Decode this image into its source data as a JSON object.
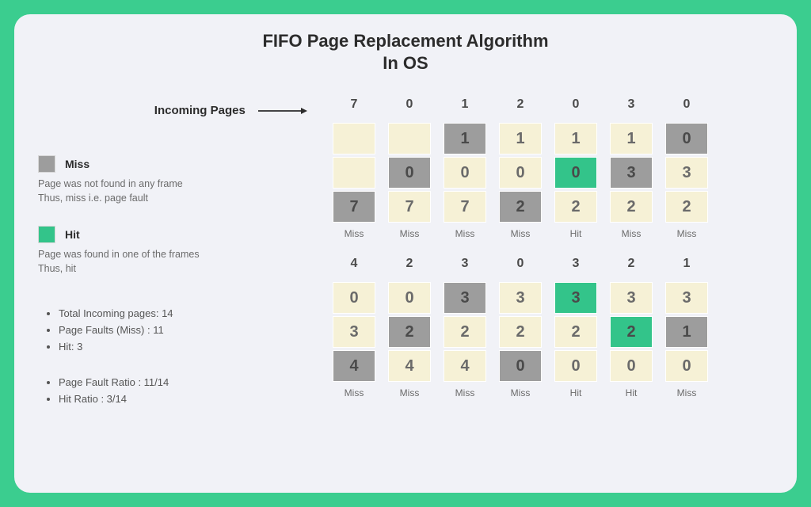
{
  "title_line1": "FIFO Page Replacement Algorithm",
  "title_line2": "In OS",
  "incoming_label": "Incoming Pages",
  "legend": {
    "miss": {
      "name": "Miss",
      "desc": "Page was not found in any frame\nThus, miss i.e. page fault"
    },
    "hit": {
      "name": "Hit",
      "desc": "Page was found in one of the frames\nThus, hit"
    }
  },
  "stats1": [
    "Total Incoming pages:  14",
    "Page Faults (Miss) : 11",
    "Hit: 3"
  ],
  "stats2": [
    "Page Fault Ratio : 11/14",
    "Hit Ratio : 3/14"
  ],
  "row1": [
    {
      "page": "7",
      "cells": [
        {
          "v": "",
          "c": "cream",
          "empty": true
        },
        {
          "v": "",
          "c": "cream",
          "empty": true
        },
        {
          "v": "7",
          "c": "gray"
        }
      ],
      "status": "Miss"
    },
    {
      "page": "0",
      "cells": [
        {
          "v": "",
          "c": "cream",
          "empty": true
        },
        {
          "v": "0",
          "c": "gray"
        },
        {
          "v": "7",
          "c": "cream"
        }
      ],
      "status": "Miss"
    },
    {
      "page": "1",
      "cells": [
        {
          "v": "1",
          "c": "gray"
        },
        {
          "v": "0",
          "c": "cream"
        },
        {
          "v": "7",
          "c": "cream"
        }
      ],
      "status": "Miss"
    },
    {
      "page": "2",
      "cells": [
        {
          "v": "1",
          "c": "cream"
        },
        {
          "v": "0",
          "c": "cream"
        },
        {
          "v": "2",
          "c": "gray"
        }
      ],
      "status": "Miss"
    },
    {
      "page": "0",
      "cells": [
        {
          "v": "1",
          "c": "cream"
        },
        {
          "v": "0",
          "c": "green"
        },
        {
          "v": "2",
          "c": "cream"
        }
      ],
      "status": "Hit"
    },
    {
      "page": "3",
      "cells": [
        {
          "v": "1",
          "c": "cream"
        },
        {
          "v": "3",
          "c": "gray"
        },
        {
          "v": "2",
          "c": "cream"
        }
      ],
      "status": "Miss"
    },
    {
      "page": "0",
      "cells": [
        {
          "v": "0",
          "c": "gray"
        },
        {
          "v": "3",
          "c": "cream"
        },
        {
          "v": "2",
          "c": "cream"
        }
      ],
      "status": "Miss"
    }
  ],
  "row2": [
    {
      "page": "4",
      "cells": [
        {
          "v": "0",
          "c": "cream"
        },
        {
          "v": "3",
          "c": "cream"
        },
        {
          "v": "4",
          "c": "gray"
        }
      ],
      "status": "Miss"
    },
    {
      "page": "2",
      "cells": [
        {
          "v": "0",
          "c": "cream"
        },
        {
          "v": "2",
          "c": "gray"
        },
        {
          "v": "4",
          "c": "cream"
        }
      ],
      "status": "Miss"
    },
    {
      "page": "3",
      "cells": [
        {
          "v": "3",
          "c": "gray"
        },
        {
          "v": "2",
          "c": "cream"
        },
        {
          "v": "4",
          "c": "cream"
        }
      ],
      "status": "Miss"
    },
    {
      "page": "0",
      "cells": [
        {
          "v": "3",
          "c": "cream"
        },
        {
          "v": "2",
          "c": "cream"
        },
        {
          "v": "0",
          "c": "gray"
        }
      ],
      "status": "Miss"
    },
    {
      "page": "3",
      "cells": [
        {
          "v": "3",
          "c": "green"
        },
        {
          "v": "2",
          "c": "cream"
        },
        {
          "v": "0",
          "c": "cream"
        }
      ],
      "status": "Hit"
    },
    {
      "page": "2",
      "cells": [
        {
          "v": "3",
          "c": "cream"
        },
        {
          "v": "2",
          "c": "green"
        },
        {
          "v": "0",
          "c": "cream"
        }
      ],
      "status": "Hit"
    },
    {
      "page": "1",
      "cells": [
        {
          "v": "3",
          "c": "cream"
        },
        {
          "v": "1",
          "c": "gray"
        },
        {
          "v": "0",
          "c": "cream"
        }
      ],
      "status": "Miss"
    }
  ]
}
